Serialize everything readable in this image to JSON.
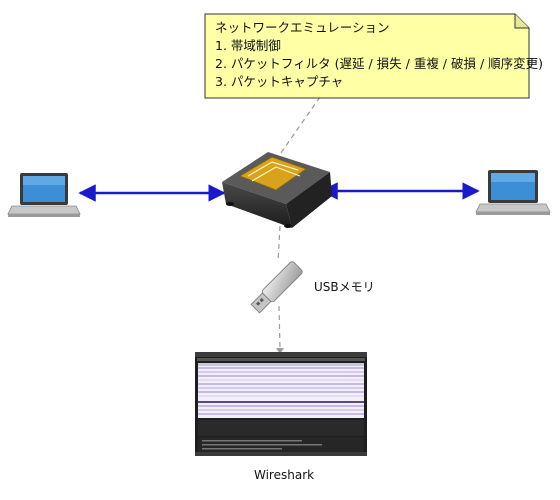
{
  "note": {
    "title": "ネットワークエミュレーション",
    "items": [
      "1. 帯域制御",
      "2. パケットフィルタ (遅延 / 損失 / 重複 / 破損 / 順序変更)",
      "3. パケットキャプチャ"
    ]
  },
  "usb_label": "USBメモリ",
  "wireshark_label": "Wireshark",
  "colors": {
    "link": "#1a1acc",
    "note_fill": "#ffffa6",
    "device_body": "#2d2d2d",
    "device_panel": "#d9a21c"
  },
  "icons": {
    "left_host": "laptop-icon",
    "right_host": "laptop-icon",
    "center": "network-emulator-device-icon",
    "usb": "usb-memory-icon",
    "capture": "wireshark-window-icon"
  }
}
